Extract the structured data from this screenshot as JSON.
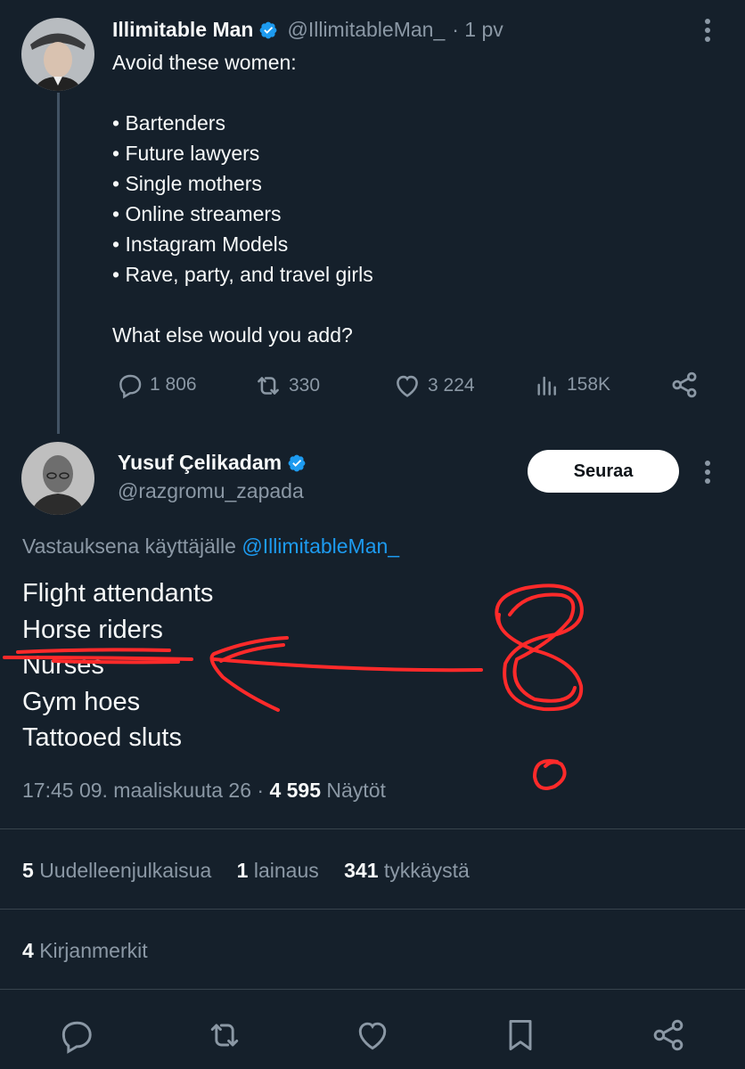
{
  "tweet": {
    "author_name": "Illimitable Man",
    "handle": "@IllimitableMan_",
    "time": "· 1 pv",
    "intro": "Avoid these women:",
    "bullets": [
      "• Bartenders",
      "• Future lawyers",
      "• Single mothers",
      "• Online streamers",
      "• Instagram Models",
      "• Rave, party, and travel girls"
    ],
    "question": "What else would you add?",
    "replies": "1 806",
    "retweets": "330",
    "likes": "3 224",
    "views": "158K"
  },
  "reply": {
    "author_name": "Yusuf Çelikadam",
    "handle": "@razgromu_zapada",
    "follow_label": "Seuraa",
    "replying_to_prefix": "Vastauksena käyttäjälle",
    "replying_to_handle": "@IllimitableMan_",
    "lines": [
      "Flight attendants",
      "Horse riders",
      "Nurses",
      "Gym hoes",
      "Tattooed sluts"
    ],
    "timestamp": "17:45 09. maaliskuuta 26 ·",
    "views_count": "4 595",
    "views_label": "Näytöt"
  },
  "stats": {
    "reposts_count": "5",
    "reposts_label": "Uudelleenjulkaisua",
    "quotes_count": "1",
    "quotes_label": "lainaus",
    "likes_count": "341",
    "likes_label": "tykkäystä",
    "bookmarks_count": "4",
    "bookmarks_label": "Kirjanmerkit"
  },
  "colors": {
    "background": "#15202b",
    "text": "#f7f9f9",
    "muted": "#8b98a5",
    "link": "#1d9bf0",
    "annotation": "#ff2a2a"
  },
  "icons": [
    "reply-icon",
    "retweet-icon",
    "like-icon",
    "views-icon",
    "share-icon",
    "bookmark-icon",
    "verified-icon",
    "more-icon"
  ]
}
